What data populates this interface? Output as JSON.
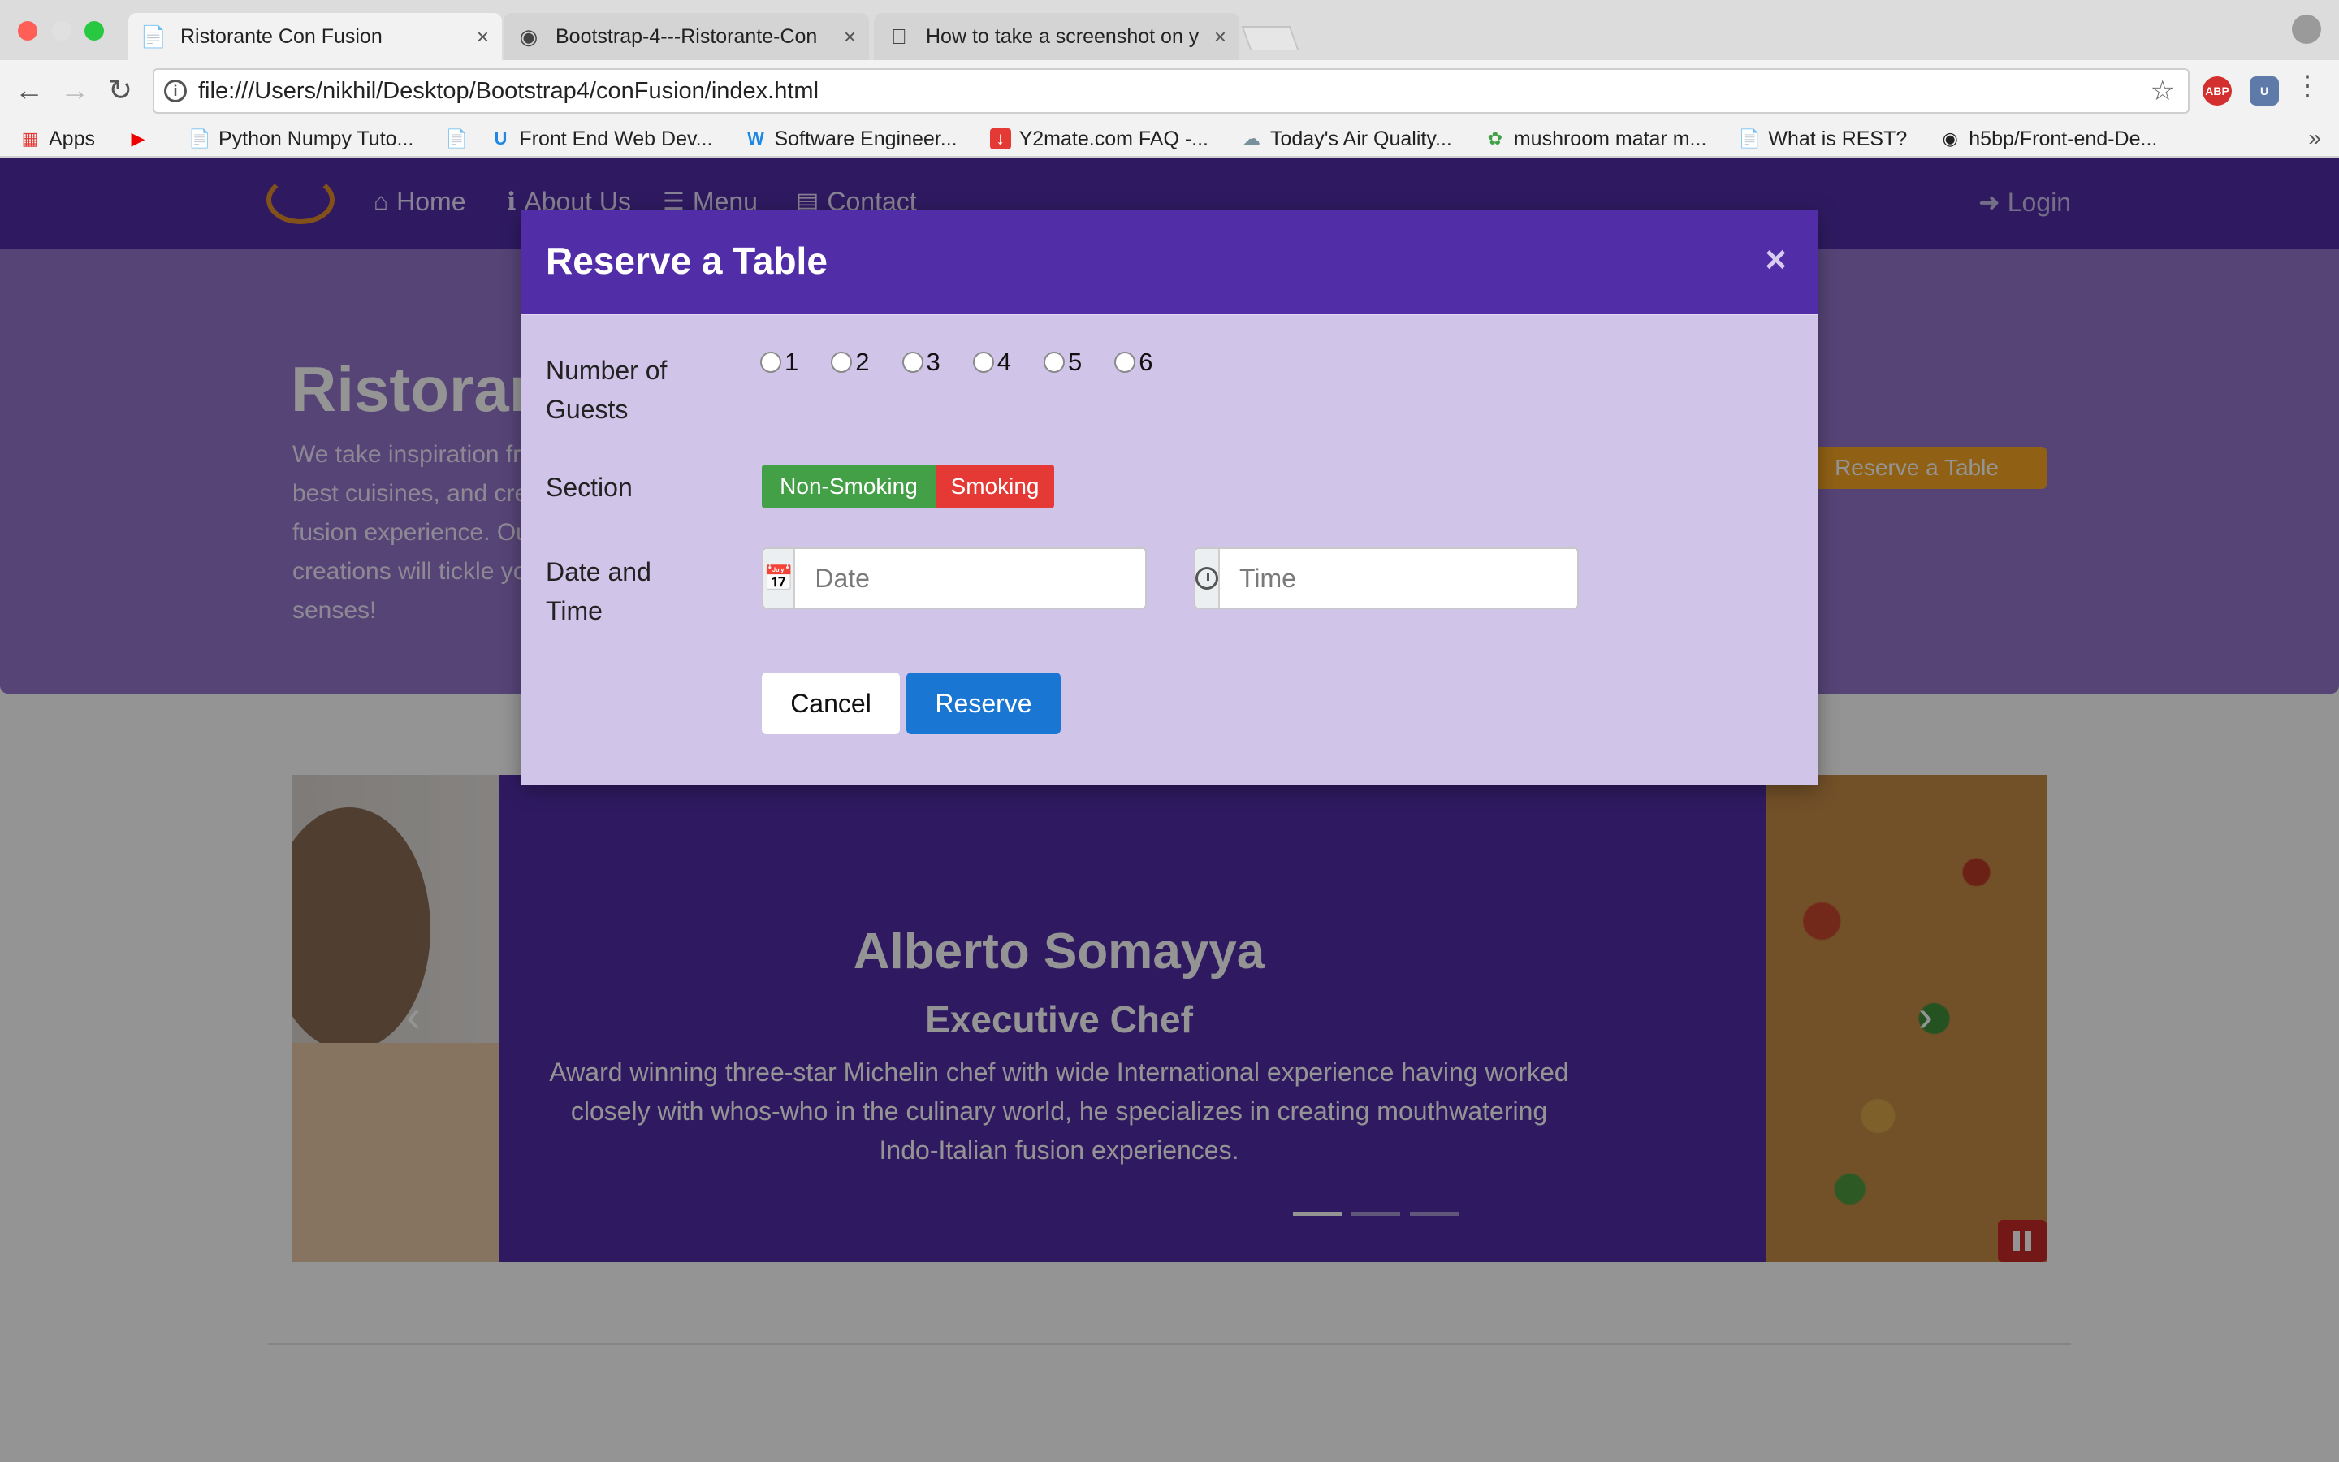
{
  "browser": {
    "tabs": [
      {
        "title": "Ristorante Con Fusion",
        "active": true
      },
      {
        "title": "Bootstrap-4---Ristorante-Con",
        "active": false
      },
      {
        "title": "How to take a screenshot on y",
        "active": false
      }
    ],
    "url": "file:///Users/nikhil/Desktop/Bootstrap4/conFusion/index.html",
    "bookmarks": [
      {
        "label": "Apps",
        "icon": "apps-grid-icon"
      },
      {
        "label": "",
        "icon": "youtube-icon"
      },
      {
        "label": "Python Numpy Tuto...",
        "icon": "page-icon"
      },
      {
        "label": "",
        "icon": "page-icon"
      },
      {
        "label": "Front End Web Dev...",
        "icon": "udemy-icon"
      },
      {
        "label": "Software Engineer...",
        "icon": "w-icon"
      },
      {
        "label": "Y2mate.com FAQ -...",
        "icon": "download-icon"
      },
      {
        "label": "Today's Air Quality...",
        "icon": "cloud-icon"
      },
      {
        "label": "mushroom matar m...",
        "icon": "leaf-icon"
      },
      {
        "label": "What is REST?",
        "icon": "page-icon"
      },
      {
        "label": "h5bp/Front-end-De...",
        "icon": "github-icon"
      }
    ],
    "extensions": {
      "abp": "ABP",
      "other": "U"
    }
  },
  "navbar": {
    "home": "Home",
    "about": "About Us",
    "menu": "Menu",
    "contact": "Contact",
    "login": "Login"
  },
  "hero": {
    "title": "Ristorante con Fusion",
    "text": "We take inspiration from the World's best cuisines, and create a unique fusion experience. Our lipsmacking creations will tickle your culinary senses!",
    "button": "Reserve a Table"
  },
  "carousel": {
    "name": "Alberto Somayya",
    "role": "Executive Chef",
    "description": "Award winning three-star Michelin chef with wide International experience having worked closely with whos-who in the culinary world, he specializes in creating mouthwatering Indo-Italian fusion experiences."
  },
  "modal": {
    "title": "Reserve a Table",
    "close": "×",
    "guests_label": "Number of Guests",
    "guest_options": [
      "1",
      "2",
      "3",
      "4",
      "5",
      "6"
    ],
    "section_label": "Section",
    "section_options": [
      "Non-Smoking",
      "Smoking"
    ],
    "datetime_label": "Date and Time",
    "date_placeholder": "Date",
    "time_placeholder": "Time",
    "cancel": "Cancel",
    "reserve": "Reserve"
  },
  "colors": {
    "primary": "#512da8",
    "primary_light": "#9575cd",
    "modal_body": "#d1c4e9",
    "success": "#43a047",
    "danger": "#e53935",
    "accent": "#1976d2",
    "warning": "#f9a825"
  }
}
